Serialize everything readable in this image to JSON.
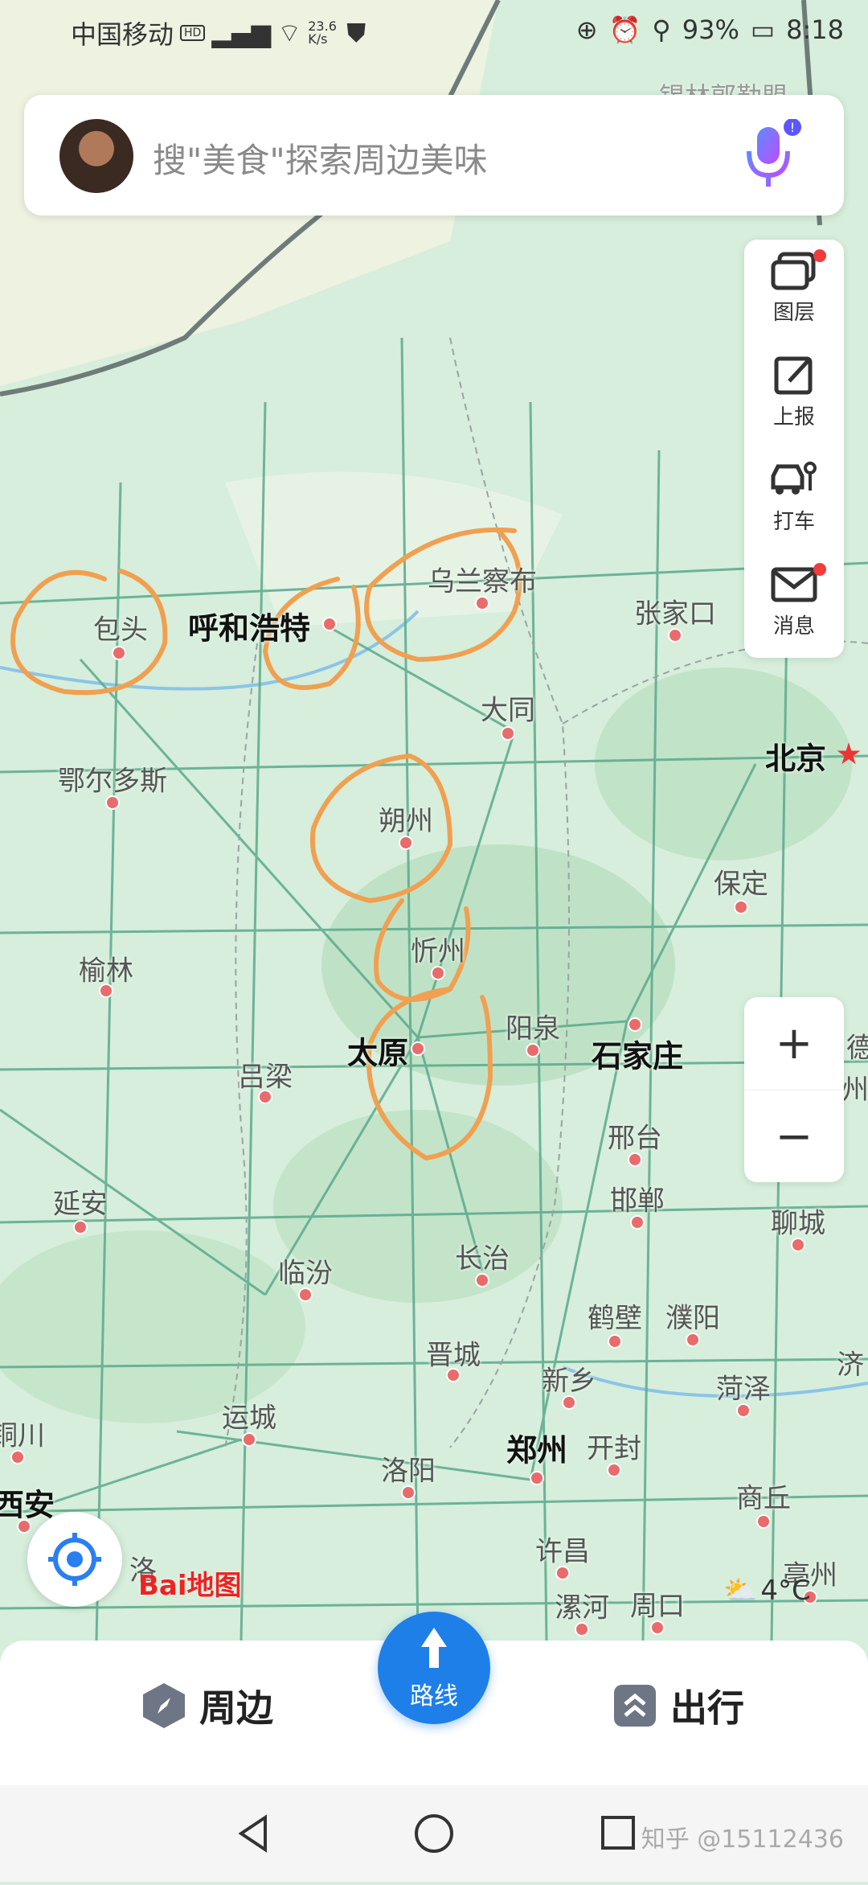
{
  "status": {
    "carrier": "中国移动",
    "network": "HD",
    "speed": "23.6 K/s",
    "battery": "93%",
    "time": "8:18"
  },
  "search": {
    "placeholder": "搜\"美食\"探索周边美味"
  },
  "map_edge_label": "锡林郭勒盟",
  "tools": [
    {
      "label": "图层",
      "icon": "layers-icon"
    },
    {
      "label": "上报",
      "icon": "report-icon"
    },
    {
      "label": "打车",
      "icon": "taxi-icon"
    },
    {
      "label": "消息",
      "icon": "message-icon"
    }
  ],
  "cities": [
    {
      "name": "包头",
      "major": false
    },
    {
      "name": "呼和浩特",
      "major": true
    },
    {
      "name": "乌兰察布",
      "major": false
    },
    {
      "name": "张家口",
      "major": false
    },
    {
      "name": "大同",
      "major": false
    },
    {
      "name": "北京",
      "major": true
    },
    {
      "name": "鄂尔多斯",
      "major": false
    },
    {
      "name": "朔州",
      "major": false
    },
    {
      "name": "保定",
      "major": false
    },
    {
      "name": "榆林",
      "major": false
    },
    {
      "name": "忻州",
      "major": false
    },
    {
      "name": "阳泉",
      "major": false
    },
    {
      "name": "石家庄",
      "major": true
    },
    {
      "name": "太原",
      "major": true
    },
    {
      "name": "吕梁",
      "major": false
    },
    {
      "name": "邢台",
      "major": false
    },
    {
      "name": "邯郸",
      "major": false
    },
    {
      "name": "延安",
      "major": false
    },
    {
      "name": "聊城",
      "major": false
    },
    {
      "name": "临汾",
      "major": false
    },
    {
      "name": "长治",
      "major": false
    },
    {
      "name": "鹤壁",
      "major": false
    },
    {
      "name": "濮阳",
      "major": false
    },
    {
      "name": "晋城",
      "major": false
    },
    {
      "name": "新乡",
      "major": false
    },
    {
      "name": "菏泽",
      "major": false
    },
    {
      "name": "运城",
      "major": false
    },
    {
      "name": "郑州",
      "major": true
    },
    {
      "name": "开封",
      "major": false
    },
    {
      "name": "洛阳",
      "major": false
    },
    {
      "name": "商丘",
      "major": false
    },
    {
      "name": "铜川",
      "major": false
    },
    {
      "name": "西安",
      "major": true
    },
    {
      "name": "许昌",
      "major": false
    },
    {
      "name": "漯河",
      "major": false
    },
    {
      "name": "周口",
      "major": false
    },
    {
      "name": "亳州",
      "major": false
    },
    {
      "name": "济",
      "major": false
    },
    {
      "name": "德",
      "major": false
    },
    {
      "name": "州",
      "major": false
    },
    {
      "name": "洛",
      "major": false
    }
  ],
  "logo_text": "Bai地图",
  "weather": {
    "temp": "4°C"
  },
  "bottom_nav": {
    "nearby": "周边",
    "route": "路线",
    "travel": "出行"
  },
  "zoom": {
    "in": "+",
    "out": "−"
  },
  "watermark": "知乎 @15112436"
}
